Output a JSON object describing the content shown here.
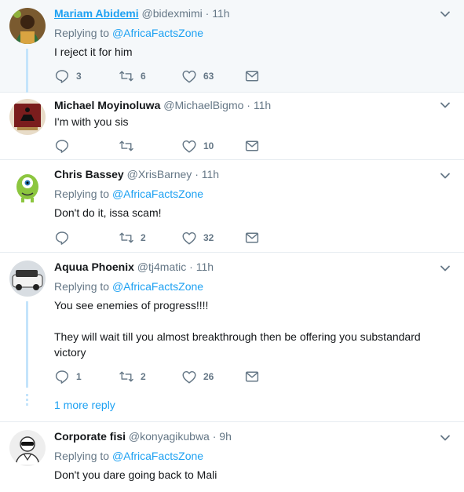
{
  "tweets": [
    {
      "name": "Mariam Abidemi",
      "handle": "@bidexmimi",
      "dot": "·",
      "time": "11h",
      "replying_prefix": "Replying to",
      "replying_to": "@AfricaFactsZone",
      "text": "I reject it for him",
      "reply_count": "3",
      "retweet_count": "6",
      "like_count": "63"
    },
    {
      "name": "Michael Moyinoluwa",
      "handle": "@MichaelBigmo",
      "dot": "·",
      "time": "11h",
      "text": "I'm with you sis",
      "reply_count": "",
      "retweet_count": "",
      "like_count": "10"
    },
    {
      "name": "Chris Bassey",
      "handle": "@XrisBarney",
      "dot": "·",
      "time": "11h",
      "replying_prefix": "Replying to",
      "replying_to": "@AfricaFactsZone",
      "text": "Don't do it, issa scam!",
      "reply_count": "",
      "retweet_count": "2",
      "like_count": "32"
    },
    {
      "name": "Aquua Phoenix",
      "handle": "@tj4matic",
      "dot": "·",
      "time": "11h",
      "replying_prefix": "Replying to",
      "replying_to": "@AfricaFactsZone",
      "text": "You see enemies of progress!!!!\n\nThey will wait till you almost breakthrough then be offering you substandard victory",
      "reply_count": "1",
      "retweet_count": "2",
      "like_count": "26",
      "more_replies": "1 more reply"
    },
    {
      "name": "Corporate fisi",
      "handle": "@konyagikubwa",
      "dot": "·",
      "time": "9h",
      "replying_prefix": "Replying to",
      "replying_to": "@AfricaFactsZone",
      "text": "Don't you dare going back to Mali"
    }
  ],
  "colors": {
    "accent": "#1da1f2",
    "muted": "#657786",
    "text": "#14171a",
    "thread_line": "#c4e4fb",
    "highlight_bg": "#f5f8fa"
  },
  "icons": [
    "reply-icon",
    "retweet-icon",
    "like-icon",
    "direct-message-icon",
    "chevron-down-icon"
  ]
}
